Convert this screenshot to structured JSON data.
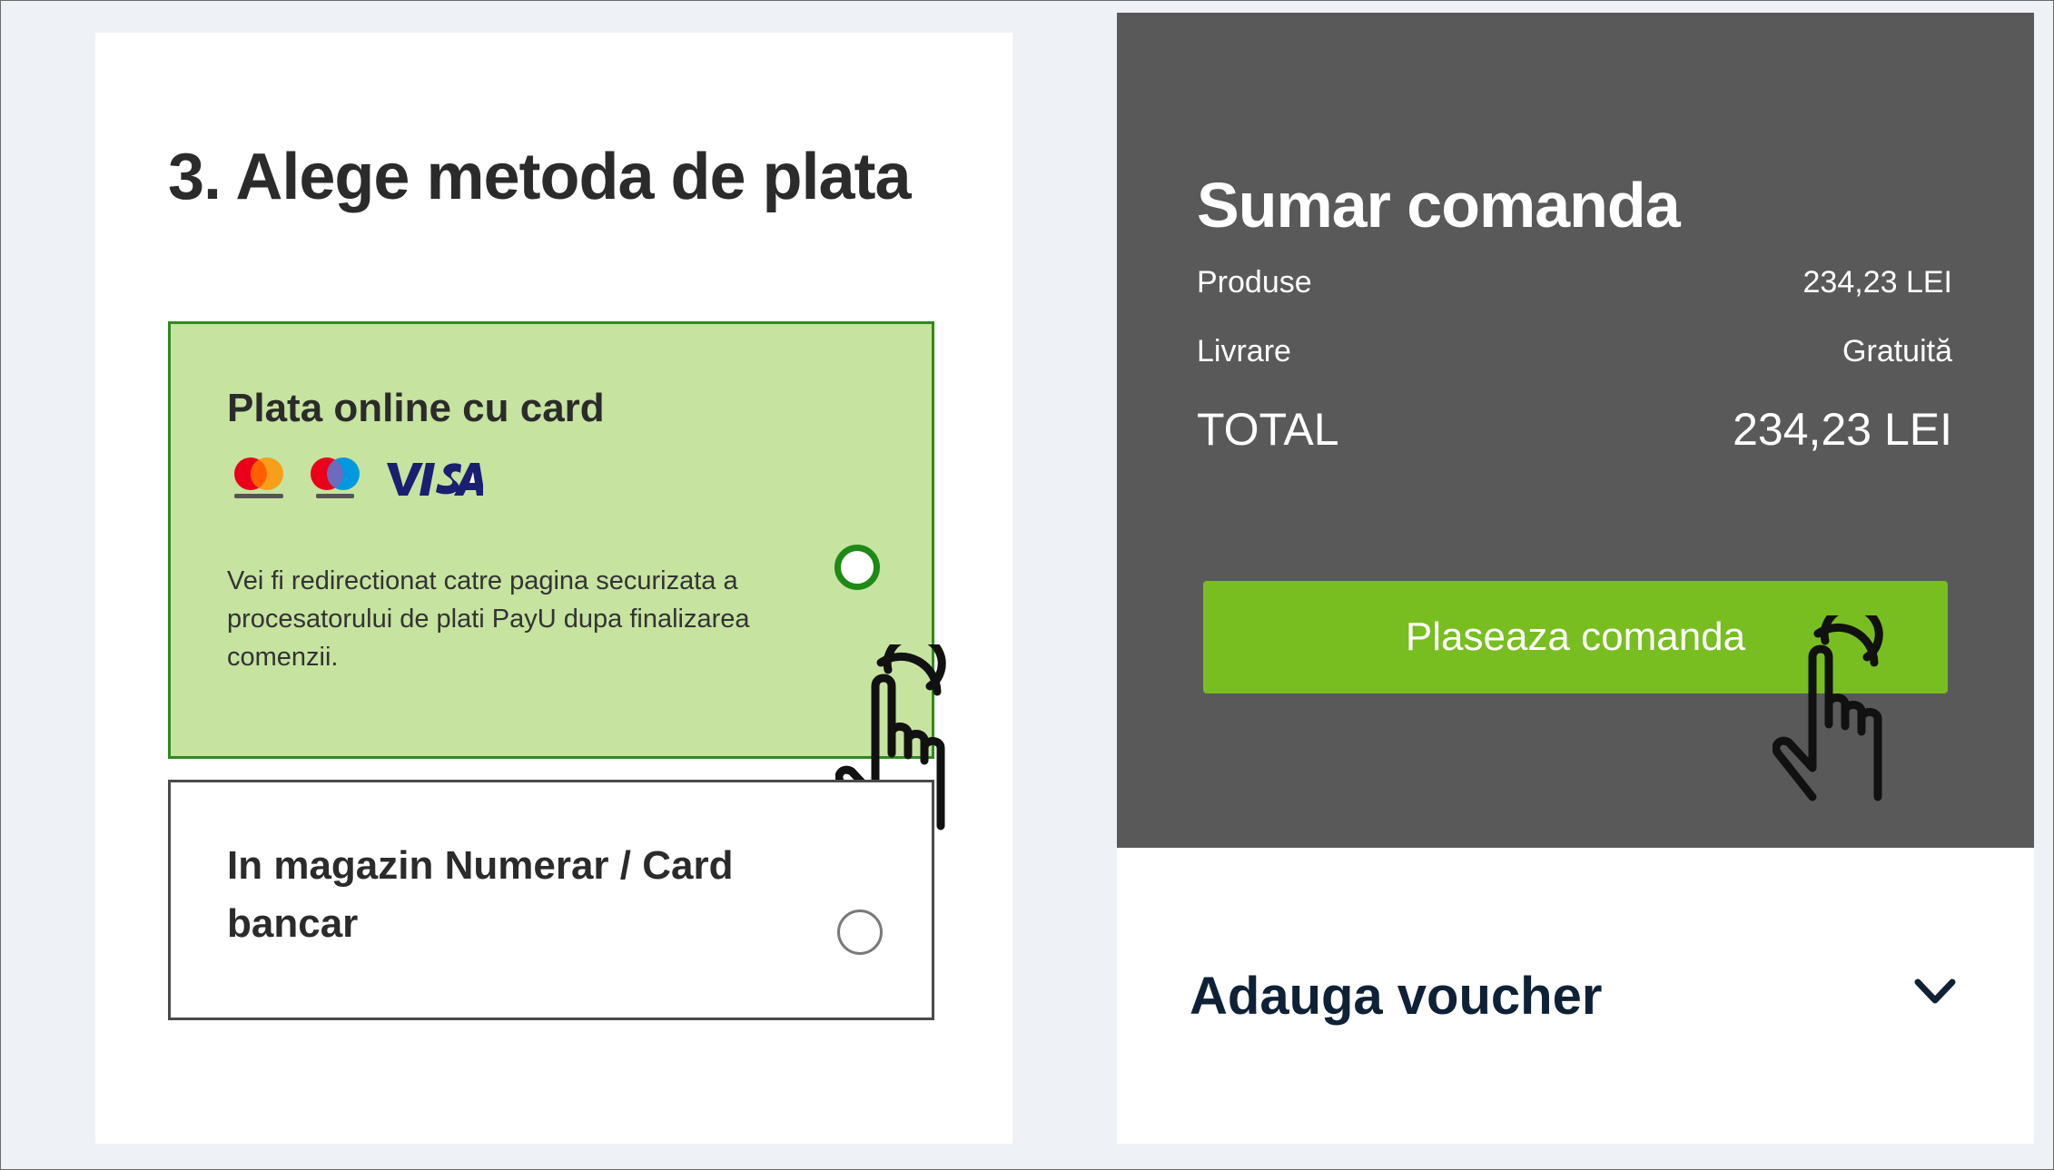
{
  "payment": {
    "section_title": "3. Alege metoda de plata",
    "options": [
      {
        "title": "Plata online cu card",
        "selected": true,
        "logos": [
          "mastercard",
          "maestro",
          "VISA"
        ],
        "description": "Vei fi redirectionat catre pagina securizata a procesatorului de plati PayU dupa finalizarea comenzii."
      },
      {
        "title": "In magazin Numerar / Card bancar",
        "selected": false
      }
    ]
  },
  "summary": {
    "title": "Sumar comanda",
    "rows": [
      {
        "label": "Produse",
        "value": "234,23 LEI"
      },
      {
        "label": "Livrare",
        "value": "Gratuită"
      }
    ],
    "total": {
      "label": "TOTAL",
      "value": "234,23 LEI"
    },
    "place_order_label": "Plaseaza comanda"
  },
  "voucher": {
    "title": "Adauga voucher"
  },
  "colors": {
    "selected_bg": "#c6e3a0",
    "selected_border": "#2e8b1e",
    "summary_bg": "#595959",
    "button_green": "#78be21"
  },
  "icons": [
    "mastercard-logo-icon",
    "maestro-logo-icon",
    "visa-logo-icon",
    "radio-selected-icon",
    "radio-empty-icon",
    "chevron-down-icon",
    "pointer-hand-icon"
  ]
}
